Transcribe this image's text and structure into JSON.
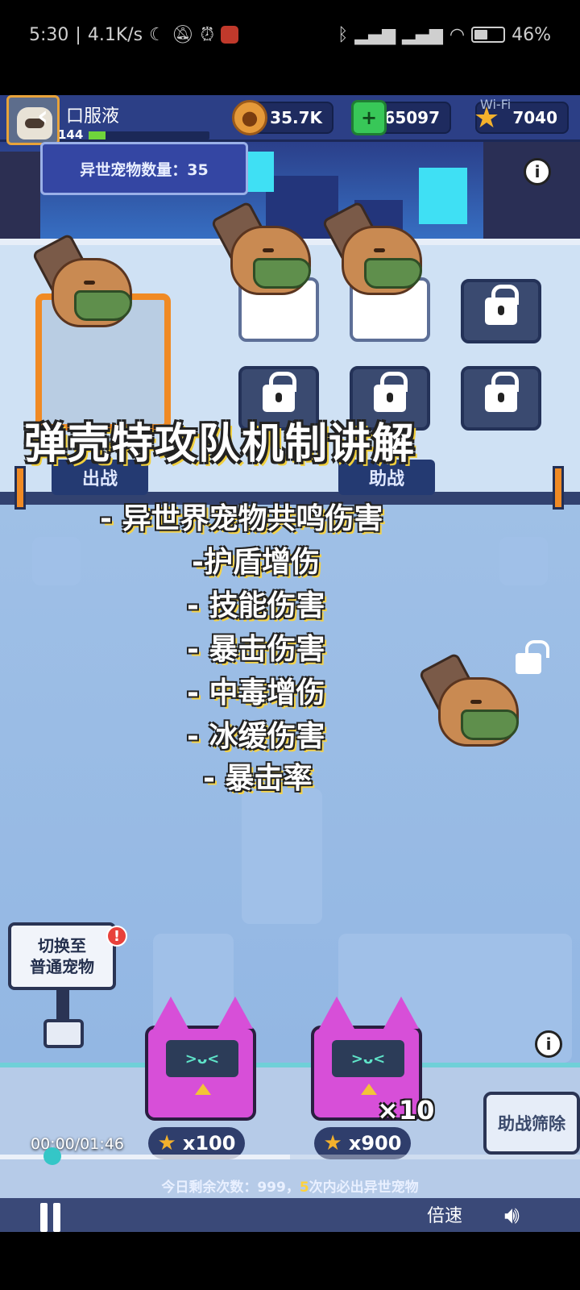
{
  "status_bar": {
    "time": "5:30",
    "net_speed": "4.1K/s",
    "battery": "46%",
    "battery_level": 0.46
  },
  "game": {
    "player_name": "口服液",
    "level": "144",
    "coins": "35.7K",
    "gems": "65097",
    "stars": "7040",
    "overlay_text": "Wi-Fi",
    "pet_count_label": "异世宠物数量：35",
    "deploy_label_left": "出战",
    "deploy_label_right": "助战",
    "switch_line1": "切换至",
    "switch_line2": "普通宠物",
    "alert": "!",
    "box1_cost": "x100",
    "box2_cost": "x900",
    "box2_multiplier": "×10",
    "robot_face": ">ᴗ<",
    "filter_button": "助战筛除",
    "daily_prefix": "今日剩余次数：999，",
    "daily_highlight": "5",
    "daily_suffix": "次内必出异世宠物",
    "info_glyph": "i"
  },
  "captions": {
    "title": "弹壳特攻队机制讲解",
    "lines": [
      "- 异世界宠物共鸣伤害",
      "-护盾增伤",
      "- 技能伤害",
      "- 暴击伤害",
      "- 中毒增伤",
      "- 冰缓伤害",
      "- 暴击率"
    ]
  },
  "video": {
    "time_display": "00:00/01:46",
    "progress": 0.0,
    "buffered": 0.5,
    "speed_label": "倍速"
  },
  "colors": {
    "accent": "#34c6c7",
    "caption_outline": "#f1cf3c",
    "slot_border": "#f08a24"
  }
}
